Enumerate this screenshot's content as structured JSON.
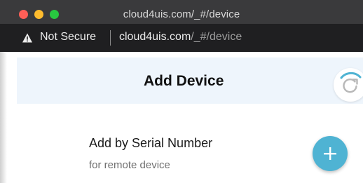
{
  "window": {
    "title": "cloud4uis.com/_#/device"
  },
  "address_bar": {
    "security_label": "Not Secure",
    "url_host": "cloud4uis.com",
    "url_path": "/_#/device",
    "warning_icon": "warning-triangle-icon"
  },
  "page": {
    "header_title": "Add Device",
    "refresh_icon": "refresh-icon",
    "item": {
      "title": "Add by Serial Number",
      "subtitle": "for remote device"
    },
    "fab_icon": "plus-icon"
  },
  "colors": {
    "header_background": "#eef5fc",
    "accent": "#4fb3d3",
    "spinner": "#4fb3d3"
  }
}
